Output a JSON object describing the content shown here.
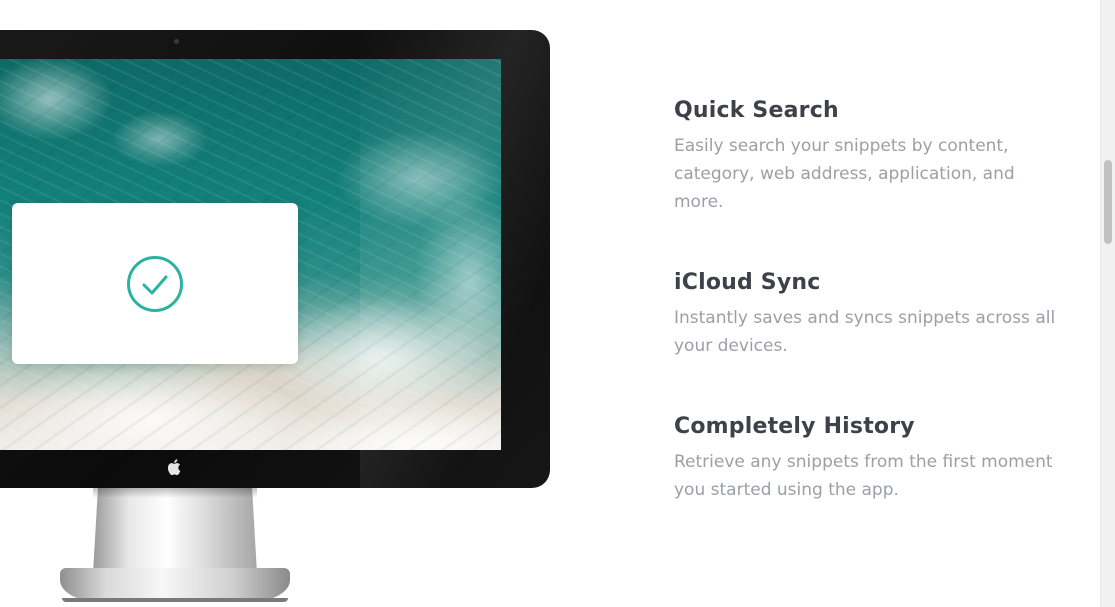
{
  "monitor": {
    "screen_icon": "checkmark-circle-icon",
    "brand_icon": "apple-logo-icon",
    "accent_color": "#2bb3a0"
  },
  "features": [
    {
      "title": "Quick Search",
      "description": "Easily search your snippets by content, category, web address, application, and more."
    },
    {
      "title": "iCloud Sync",
      "description": "Instantly saves and syncs snippets across all your devices."
    },
    {
      "title": "Completely History",
      "description": "Retrieve any snippets from the first moment you started using the app."
    }
  ],
  "colors": {
    "title": "#3d4148",
    "description": "#9aa0a8",
    "background": "#ffffff"
  }
}
